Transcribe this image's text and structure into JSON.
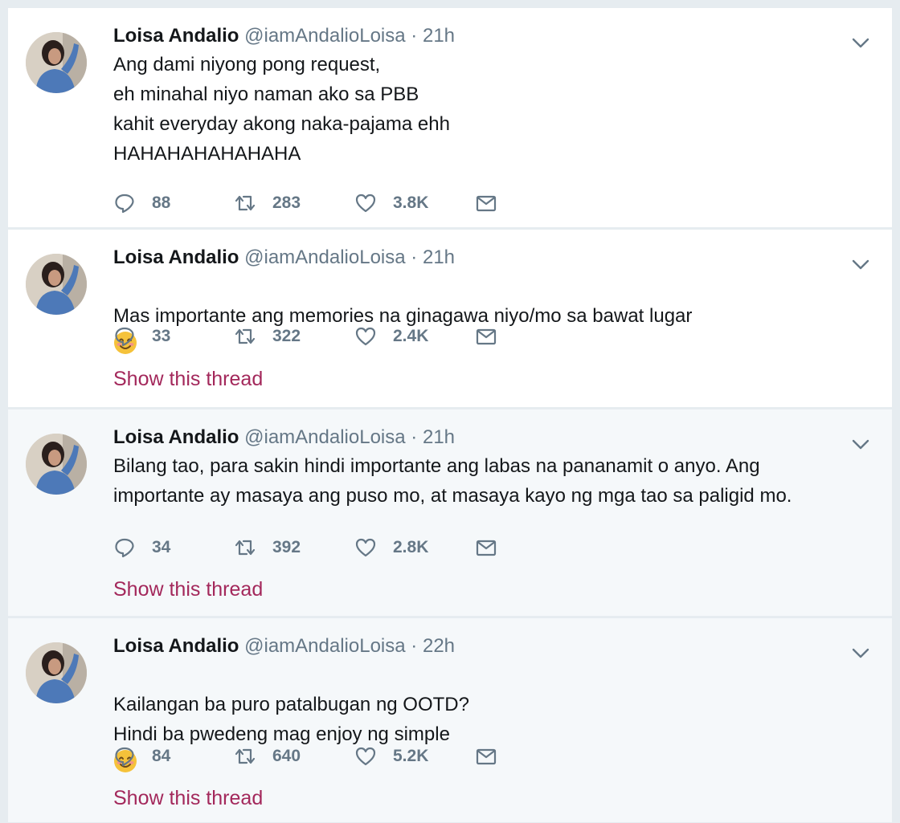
{
  "tweets": [
    {
      "name": "Loisa Andalio",
      "handle": "@iamAndalioLoisa",
      "dot": "·",
      "time": "21h",
      "text": "Ang dami niyong pong request,\neh minahal niyo naman ako sa PBB\nkahit everyday akong naka-pajama ehh\nHAHAHAHAHAHAHA",
      "replies": "88",
      "retweets": "283",
      "likes": "3.8K"
    },
    {
      "name": "Loisa Andalio",
      "handle": "@iamAndalioLoisa",
      "dot": "·",
      "time": "21h",
      "text": "Mas importante ang memories na ginagawa niyo/mo sa bawat lugar",
      "replies": "33",
      "retweets": "322",
      "likes": "2.4K",
      "thread_link": "Show this thread"
    },
    {
      "name": "Loisa Andalio",
      "handle": "@iamAndalioLoisa",
      "dot": "·",
      "time": "21h",
      "text": "Bilang tao, para sakin hindi importante ang labas na pananamit o anyo. Ang importante ay masaya ang puso mo, at masaya kayo ng mga tao sa paligid mo.",
      "replies": "34",
      "retweets": "392",
      "likes": "2.8K",
      "thread_link": "Show this thread"
    },
    {
      "name": "Loisa Andalio",
      "handle": "@iamAndalioLoisa",
      "dot": "·",
      "time": "22h",
      "text": "Kailangan ba puro patalbugan ng OOTD?\nHindi ba pwedeng mag enjoy ng simple",
      "replies": "84",
      "retweets": "640",
      "likes": "5.2K",
      "thread_link": "Show this thread"
    }
  ],
  "colors": {
    "background": "#e6ecf0",
    "icon": "#657786",
    "link": "#a3285b",
    "emoji": "#f5c23a"
  },
  "icons": [
    "reply-icon",
    "retweet-icon",
    "like-icon",
    "direct-message-icon",
    "chevron-down-icon",
    "smiling-face-emoji"
  ]
}
